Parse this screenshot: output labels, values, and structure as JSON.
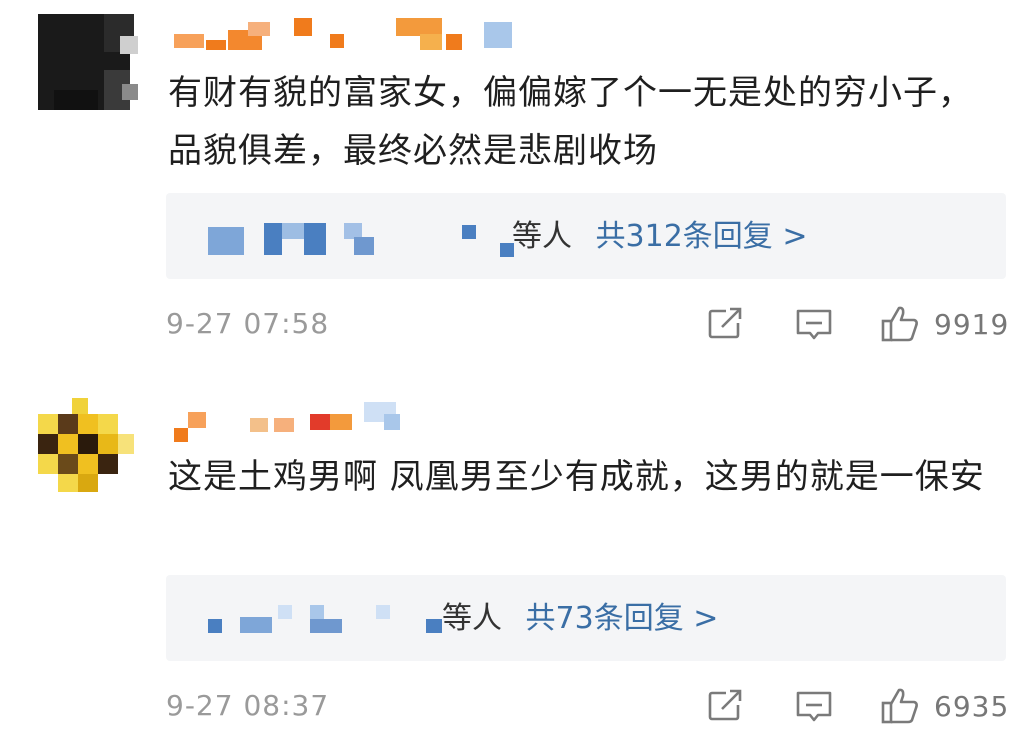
{
  "comments": [
    {
      "text": "有财有貌的富家女，偏偏嫁了个一无是处的穷小子，品貌俱差，最终必然是悲剧收场",
      "reply_suffix": "等人",
      "reply_link": "共312条回复 >",
      "timestamp": "9-27 07:58",
      "likes": "9919",
      "icons": {
        "share": "share-icon",
        "comment": "comment-icon",
        "like": "thumbs-up-icon"
      }
    },
    {
      "text": "这是土鸡男啊 凤凰男至少有成就，这男的就是一保安",
      "reply_suffix": "等人",
      "reply_link": "共73条回复 >",
      "timestamp": "9-27 08:37",
      "likes": "6935",
      "icons": {
        "share": "share-icon",
        "comment": "comment-icon",
        "like": "thumbs-up-icon"
      }
    }
  ],
  "colors": {
    "link": "#3a6ea5",
    "meta": "#9a9a9a",
    "reply_bg": "#f4f5f7",
    "name_mosaic": "#f07b1c",
    "reply_mosaic": "#4a7fc1"
  }
}
